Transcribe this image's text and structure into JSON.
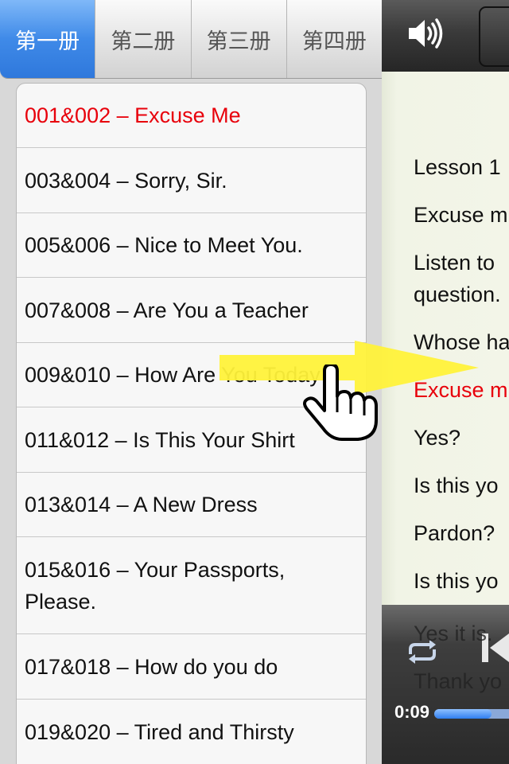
{
  "tabs": [
    {
      "label": "第一册",
      "active": true
    },
    {
      "label": "第二册",
      "active": false
    },
    {
      "label": "第三册",
      "active": false
    },
    {
      "label": "第四册",
      "active": false
    }
  ],
  "lessons": [
    {
      "label": "001&002 – Excuse Me",
      "selected": true
    },
    {
      "label": "003&004 – Sorry, Sir.",
      "selected": false
    },
    {
      "label": "005&006 – Nice to Meet You.",
      "selected": false
    },
    {
      "label": "007&008 – Are You a Teacher",
      "selected": false
    },
    {
      "label": "009&010 – How Are You Today",
      "selected": false
    },
    {
      "label": "011&012 – Is This Your Shirt",
      "selected": false
    },
    {
      "label": "013&014 – A New Dress",
      "selected": false
    },
    {
      "label": "015&016 – Your Passports, Please.",
      "selected": false
    },
    {
      "label": "017&018 – How do you do",
      "selected": false
    },
    {
      "label": "019&020 – Tired and Thirsty",
      "selected": false
    }
  ],
  "player": {
    "lyrics": [
      {
        "text": "Lesson 1",
        "current": false
      },
      {
        "text": "Excuse m",
        "current": false
      },
      {
        "text": "Listen to",
        "current": false
      },
      {
        "text": "question.",
        "current": false
      },
      {
        "text": "Whose ha",
        "current": false
      },
      {
        "text": "Excuse m",
        "current": true
      },
      {
        "text": "Yes?",
        "current": false
      },
      {
        "text": "Is this yo",
        "current": false
      },
      {
        "text": "Pardon?",
        "current": false
      },
      {
        "text": "Is this yo",
        "current": false
      }
    ],
    "lyrics_tail": [
      "Yes it is.",
      "Thank yo"
    ],
    "time": "0:09",
    "progress": 0.6
  },
  "colors": {
    "accent": "#3f8ae8",
    "selected_text": "#e8000b",
    "arrow": "#fff23a"
  },
  "icons": {
    "volume": "volume-icon",
    "repeat": "repeat-icon",
    "previous": "previous-track-icon",
    "swipe": "swipe-right-arrow-icon",
    "hand": "pointing-hand-icon"
  }
}
